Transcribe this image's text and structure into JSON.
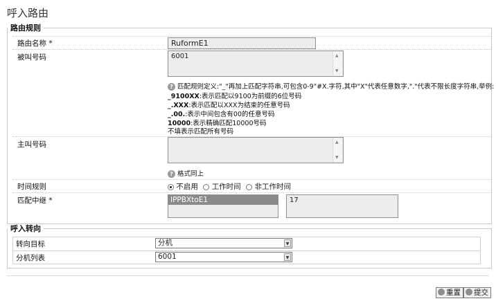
{
  "page_title": "呼入路由",
  "rules_group": {
    "legend": "路由规则",
    "route_name": {
      "label": "路由名称 *",
      "value": "RuformE1"
    },
    "called_number": {
      "label": "被叫号码",
      "value": "6001",
      "help_intro": "匹配规则定义:\"_\"再加上匹配字符串,可包含0-9\"#X.字符,其中\"X\"代表任意数字,\".\"代表不限长度字符串,举例:",
      "help_lines": [
        {
          "bold": "_9100XX",
          "text": ":表示匹配以9100为前缀的6位号码"
        },
        {
          "bold": "_.XXX",
          "text": ":表示匹配以XXX为结束的任意号码"
        },
        {
          "bold": "_.00.",
          "text": ":表示中间包含有00的任意号码"
        },
        {
          "bold": "10000",
          "text": ":表示精确匹配10000号码"
        },
        {
          "bold": "",
          "text": "不填表示匹配所有号码"
        }
      ]
    },
    "caller_number": {
      "label": "主叫号码",
      "value": "",
      "help": "格式同上"
    },
    "time_rule": {
      "label": "时间规则",
      "options": [
        {
          "label": "不启用",
          "checked": true
        },
        {
          "label": "工作时间",
          "checked": false
        },
        {
          "label": "非工作时间",
          "checked": false
        }
      ]
    },
    "trunk": {
      "label": "匹配中继 *",
      "selected_item": "IPPBXtoE1",
      "value_box": "17"
    }
  },
  "forward_group": {
    "legend": "呼入转向",
    "target": {
      "label": "转向目标",
      "value": "分机"
    },
    "extension_list": {
      "label": "分机列表",
      "value": "6001"
    }
  },
  "buttons": {
    "reset": "重置",
    "submit": "提交"
  },
  "icons": {
    "help": "question-circle-icon",
    "reset": "reset-icon",
    "submit": "submit-check-icon"
  }
}
